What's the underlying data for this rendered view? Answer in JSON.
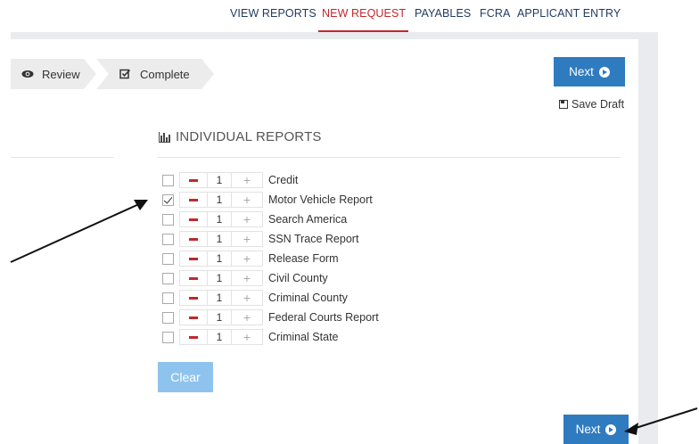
{
  "nav": {
    "items": [
      {
        "label": "VIEW REPORTS",
        "active": false
      },
      {
        "label": "NEW REQUEST",
        "active": true
      },
      {
        "label": "PAYABLES",
        "active": false
      },
      {
        "label": "FCRA",
        "active": false
      },
      {
        "label": "APPLICANT ENTRY",
        "active": false
      }
    ]
  },
  "steps": {
    "review": "Review",
    "complete": "Complete"
  },
  "actions": {
    "next_label": "Next",
    "save_draft_label": "Save Draft",
    "clear_label": "Clear"
  },
  "section": {
    "title": "INDIVIDUAL REPORTS"
  },
  "reports": [
    {
      "label": "Credit",
      "checked": false,
      "qty": "1"
    },
    {
      "label": "Motor Vehicle Report",
      "checked": true,
      "qty": "1"
    },
    {
      "label": "Search America",
      "checked": false,
      "qty": "1"
    },
    {
      "label": "SSN Trace Report",
      "checked": false,
      "qty": "1"
    },
    {
      "label": "Release Form",
      "checked": false,
      "qty": "1"
    },
    {
      "label": "Civil County",
      "checked": false,
      "qty": "1"
    },
    {
      "label": "Criminal County",
      "checked": false,
      "qty": "1"
    },
    {
      "label": "Federal Courts Report",
      "checked": false,
      "qty": "1"
    },
    {
      "label": "Criminal State",
      "checked": false,
      "qty": "1"
    }
  ],
  "colors": {
    "accent": "#2f7bbf",
    "active_nav": "#c0282d",
    "clear_button": "#8ec3ee"
  }
}
